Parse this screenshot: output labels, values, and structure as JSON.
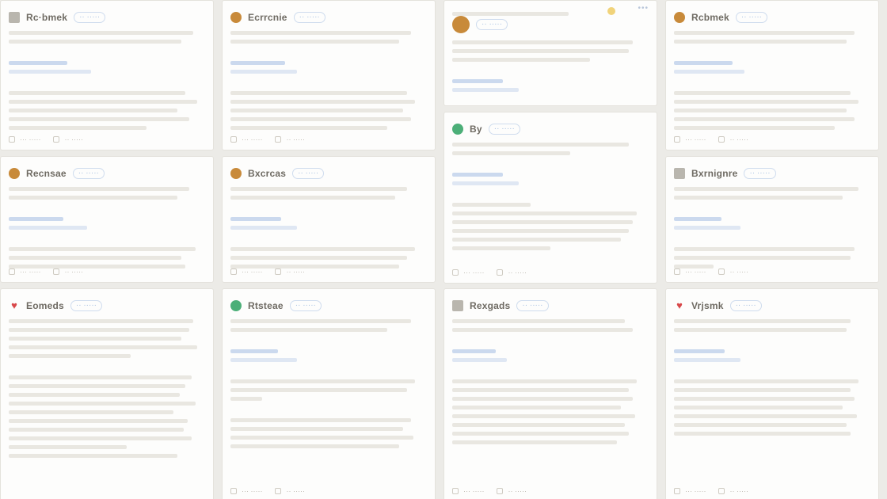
{
  "cards": [
    {
      "name": "Rc·bmek",
      "badge": "·· ·····",
      "icon": "document-icon"
    },
    {
      "name": "Ecrrcnie",
      "badge": "·· ·····",
      "icon": "avatar-icon"
    },
    {
      "name": "Rcbmek",
      "badge": "·· ·····",
      "icon": "avatar-icon"
    },
    {
      "name": "Recnsae",
      "badge": "·· ·····",
      "icon": "avatar-icon"
    },
    {
      "name": "Bxcrcas",
      "badge": "·· ·····",
      "icon": "avatar-icon"
    },
    {
      "name": "By",
      "badge": "·· ·····",
      "icon": "avatar-icon"
    },
    {
      "name": "Bxrnignre",
      "badge": "·· ·····",
      "icon": "document-icon"
    },
    {
      "name": "Eomeds",
      "badge": "·· ·····",
      "icon": "heart-icon"
    },
    {
      "name": "Rtsteae",
      "badge": "·· ·····",
      "icon": "avatar-icon"
    },
    {
      "name": "Rexgads",
      "badge": "·· ·····",
      "icon": "document-icon"
    },
    {
      "name": "Vrjsmk",
      "badge": "·· ·····",
      "icon": "heart-icon"
    }
  ],
  "footer": {
    "left": "··· ·····",
    "right": "·· ·····"
  },
  "colors": {
    "accent": "#cbd9ee",
    "heart": "#d8484a",
    "avatar": "#c88a3a",
    "green": "#4caf78"
  }
}
